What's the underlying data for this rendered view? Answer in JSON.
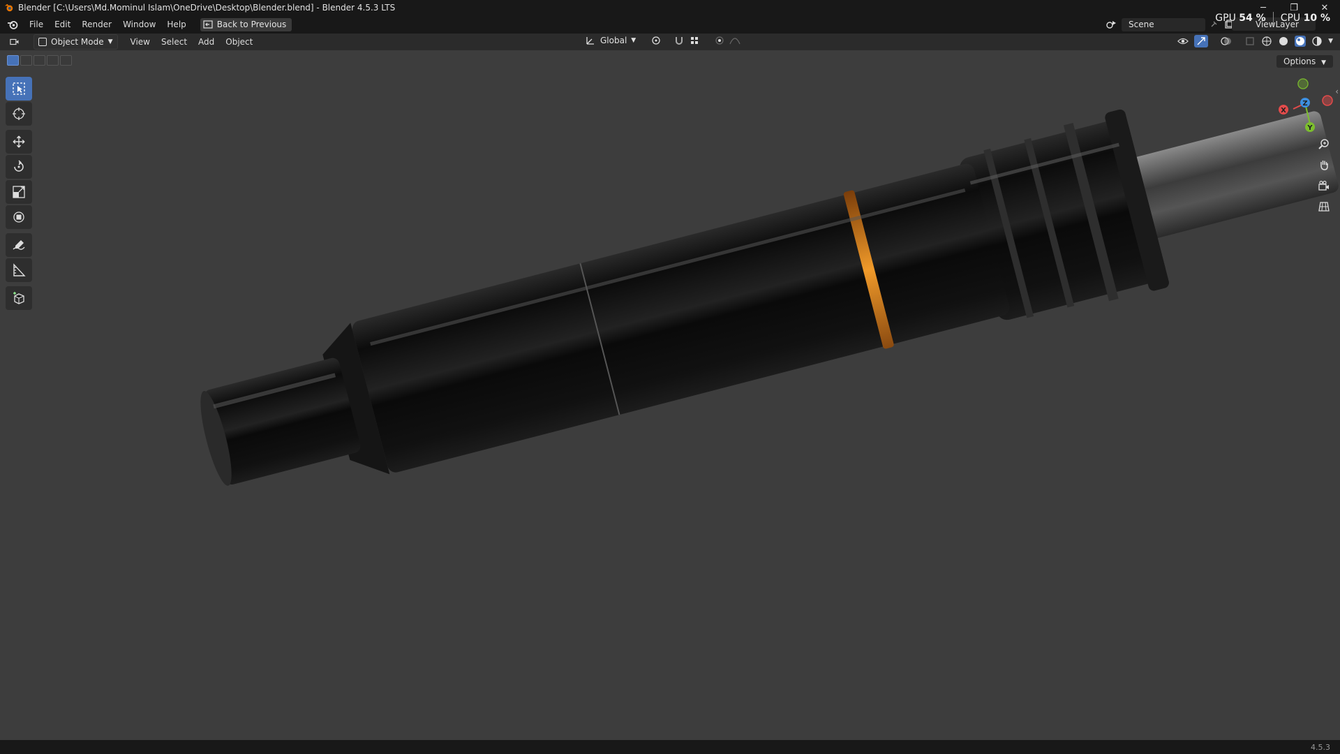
{
  "window": {
    "title": "Blender [C:\\Users\\Md.Mominul Islam\\OneDrive\\Desktop\\Blender.blend] - Blender 4.5.3 LTS",
    "minimize": "─",
    "restore": "❐",
    "close": "✕"
  },
  "menu": {
    "items": [
      "File",
      "Edit",
      "Render",
      "Window",
      "Help"
    ],
    "back_button": "Back to Previous"
  },
  "scene": {
    "label": "Scene"
  },
  "view_layer": {
    "label": "ViewLayer"
  },
  "stats": {
    "gpu_label": "GPU",
    "gpu_value": "54 %",
    "cpu_label": "CPU",
    "cpu_value": "10 %"
  },
  "header": {
    "mode": "Object Mode",
    "menus": [
      "View",
      "Select",
      "Add",
      "Object"
    ],
    "transform_orientation": "Global"
  },
  "options_label": "Options",
  "gizmo": {
    "x": "X",
    "y": "Y",
    "z": "Z"
  },
  "status": {
    "version": "4.5.3"
  },
  "colors": {
    "accent": "#4672b8",
    "axis_x": "#e34b4b",
    "axis_y": "#7cbf2d",
    "axis_z": "#3d8fe0",
    "ring": "#e08a1e"
  }
}
